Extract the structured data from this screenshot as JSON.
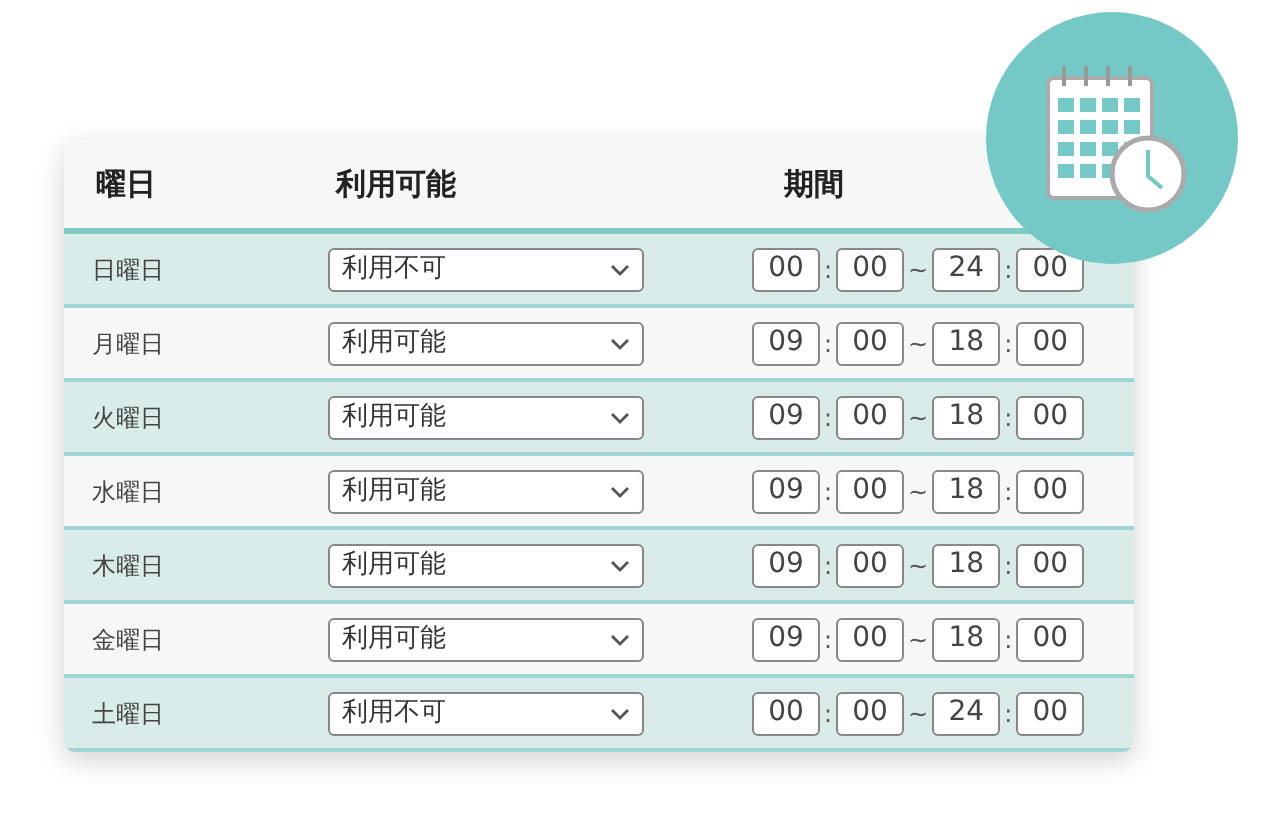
{
  "table": {
    "columns": [
      "曜日",
      "利用可能",
      "期間"
    ],
    "rows": [
      {
        "day": "日曜日",
        "availability": "利用不可",
        "start_hour": "00",
        "colon_1": ":",
        "start_min": "00",
        "tilde": "~",
        "end_hour": "24",
        "colon_2": ":",
        "end_min": "00"
      },
      {
        "day": "月曜日",
        "availability": "利用可能",
        "start_hour": "09",
        "colon_1": ":",
        "start_min": "00",
        "tilde": "~",
        "end_hour": "18",
        "colon_2": ":",
        "end_min": "00"
      },
      {
        "day": "火曜日",
        "availability": "利用可能",
        "start_hour": "09",
        "colon_1": ":",
        "start_min": "00",
        "tilde": "~",
        "end_hour": "18",
        "colon_2": ":",
        "end_min": "00"
      },
      {
        "day": "水曜日",
        "availability": "利用可能",
        "start_hour": "09",
        "colon_1": ":",
        "start_min": "00",
        "tilde": "~",
        "end_hour": "18",
        "colon_2": ":",
        "end_min": "00"
      },
      {
        "day": "木曜日",
        "availability": "利用可能",
        "start_hour": "09",
        "colon_1": ":",
        "start_min": "00",
        "tilde": "~",
        "end_hour": "18",
        "colon_2": ":",
        "end_min": "00"
      },
      {
        "day": "金曜日",
        "availability": "利用可能",
        "start_hour": "09",
        "colon_1": ":",
        "start_min": "00",
        "tilde": "~",
        "end_hour": "18",
        "colon_2": ":",
        "end_min": "00"
      },
      {
        "day": "土曜日",
        "availability": "利用不可",
        "start_hour": "00",
        "colon_1": ":",
        "start_min": "00",
        "tilde": "~",
        "end_hour": "24",
        "colon_2": ":",
        "end_min": "00"
      }
    ]
  }
}
